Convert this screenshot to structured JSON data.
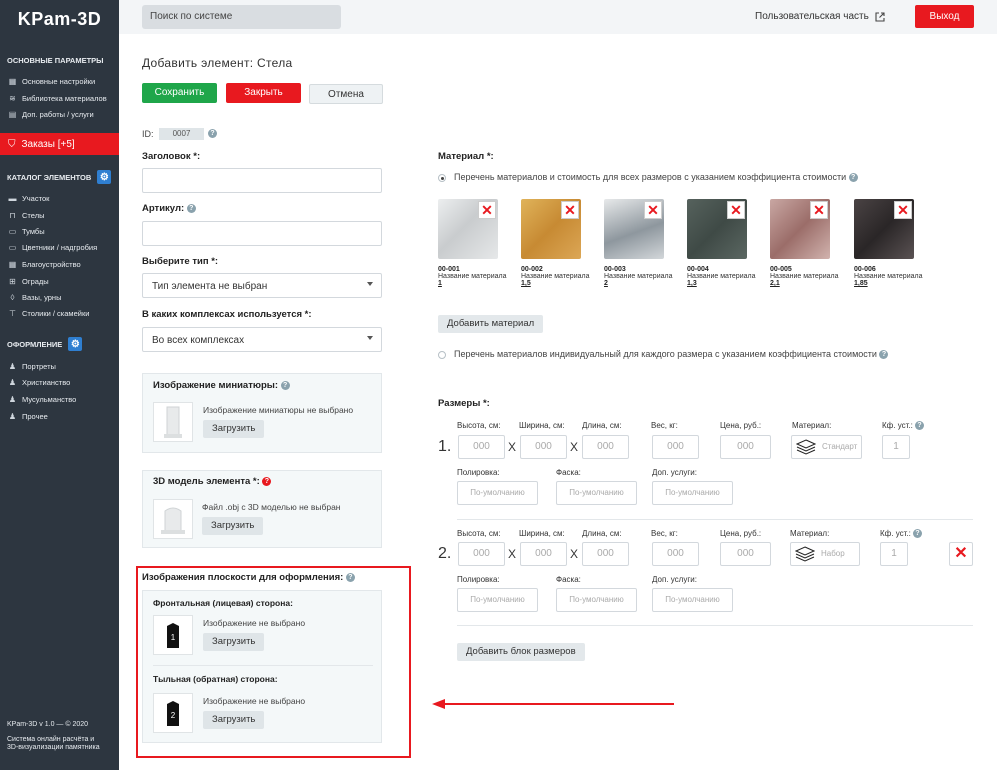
{
  "sidebar": {
    "logo": "KPam-3D",
    "section1": "ОСНОВНЫЕ ПАРАМЕТРЫ",
    "items1": [
      "Основные настройки",
      "Библиотека материалов",
      "Доп. работы / услуги"
    ],
    "orders": "Заказы [+5]",
    "section2": "КАТАЛОГ ЭЛЕМЕНТОВ",
    "items2": [
      "Участок",
      "Стелы",
      "Тумбы",
      "Цветники / надгробия",
      "Благоустройство",
      "Ограды",
      "Вазы, урны",
      "Столики / скамейки"
    ],
    "section3": "ОФОРМЛЕНИЕ",
    "items3": [
      "Портреты",
      "Христианство",
      "Мусульманство",
      "Прочее"
    ],
    "version": "KPam-3D v 1.0 —  © 2020",
    "desc1": "Система онлайн расчёта и",
    "desc2": "3D-визуализации памятника"
  },
  "topbar": {
    "search_placeholder": "Поиск по системе",
    "user_part": "Пользовательская часть",
    "exit": "Выход"
  },
  "page": {
    "title": "Добавить элемент: Стела",
    "save": "Сохранить",
    "close": "Закрыть",
    "cancel": "Отмена"
  },
  "form": {
    "id_label": "ID:",
    "id_value": "0007",
    "title_label": "Заголовок *:",
    "article_label": "Артикул:",
    "type_label": "Выберите тип *:",
    "type_value": "Тип элемента не выбран",
    "complex_label": "В каких комплексах используется *:",
    "complex_value": "Во всех комплексах",
    "thumb_title": "Изображение миниатюры:",
    "thumb_status": "Изображение миниатюры не выбрано",
    "upload": "Загрузить",
    "model_title": "3D модель элемента *:",
    "model_status": "Файл .obj с 3D моделью не выбран",
    "planes_title": "Изображения плоскости для оформления:",
    "front_title": "Фронтальная (лицевая) сторона:",
    "front_status": "Изображение не выбрано",
    "front_num": "1",
    "back_title": "Тыльная (обратная) сторона:",
    "back_status": "Изображение не выбрано",
    "back_num": "2"
  },
  "material": {
    "title": "Материал *:",
    "opt1": "Перечень материалов и стоимость для всех размеров с указанием коэффициента стоимости",
    "opt2": "Перечень материалов индивидуальный для каждого размера с указанием коэффициента стоимости",
    "add": "Добавить материал",
    "items": [
      {
        "code": "00-001",
        "name": "Название материала",
        "coef": "1",
        "color": "#d9dcdf"
      },
      {
        "code": "00-002",
        "name": "Название материала",
        "coef": "1,5",
        "color": "#d7a34a"
      },
      {
        "code": "00-003",
        "name": "Название материала",
        "coef": "2",
        "color": "#b9c0c6"
      },
      {
        "code": "00-004",
        "name": "Название материала",
        "coef": "1,3",
        "color": "#4a5752"
      },
      {
        "code": "00-005",
        "name": "Название материала",
        "coef": "2,1",
        "color": "#b48a86"
      },
      {
        "code": "00-006",
        "name": "Название материала",
        "coef": "1,85",
        "color": "#3a3536"
      }
    ]
  },
  "sizes": {
    "title": "Размеры *:",
    "h": "Высота, см:",
    "w": "Ширина, см:",
    "l": "Длина, см:",
    "wt": "Вес, кг:",
    "price": "Цена, руб.:",
    "mat": "Материал:",
    "kf": "Кф. уст.:",
    "polish": "Полировка:",
    "facet": "Фаска:",
    "extra": "Доп. услуги:",
    "ph": "000",
    "def": "По-умолчанию",
    "x": "X",
    "row1": {
      "num": "1.",
      "mat": "Стандарт",
      "kf": "1"
    },
    "row2": {
      "num": "2.",
      "mat": "Набор",
      "kf": "1"
    },
    "add": "Добавить блок размеров"
  }
}
